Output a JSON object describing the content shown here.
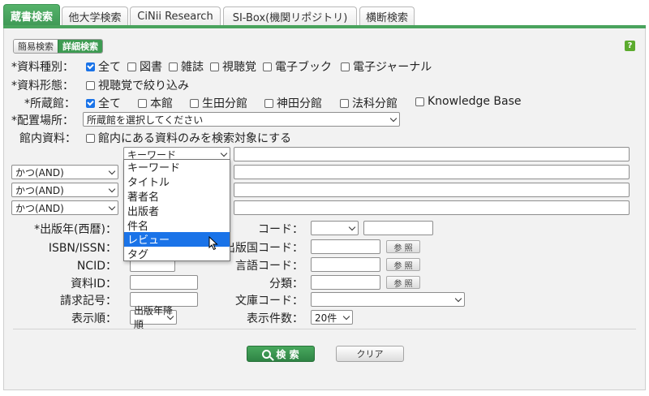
{
  "tabs": [
    "蔵書検索",
    "他大学検索",
    "CiNii Research",
    "SI-Box(機関リポジトリ)",
    "横断検索"
  ],
  "mode": {
    "simple": "簡易検索",
    "detail": "詳細検索"
  },
  "help": "?",
  "material_type": {
    "label": "*資料種別：",
    "options": [
      {
        "text": "全て",
        "checked": true
      },
      {
        "text": "図書",
        "checked": false
      },
      {
        "text": "雑誌",
        "checked": false
      },
      {
        "text": "視聴覚",
        "checked": false
      },
      {
        "text": "電子ブック",
        "checked": false
      },
      {
        "text": "電子ジャーナル",
        "checked": false
      }
    ]
  },
  "material_form": {
    "label": "*資料形態：",
    "option": "視聴覚で絞り込み"
  },
  "holding_library": {
    "label": "*所蔵館：",
    "options": [
      {
        "text": "全て",
        "checked": true
      },
      {
        "text": "本館",
        "checked": false
      },
      {
        "text": "生田分館",
        "checked": false
      },
      {
        "text": "神田分館",
        "checked": false
      },
      {
        "text": "法科分館",
        "checked": false
      },
      {
        "text": "Knowledge Base",
        "checked": false
      }
    ]
  },
  "location": {
    "label": "*配置場所：",
    "placeholder": "所蔵館を選択してください"
  },
  "in_library": {
    "label": "館内資料：",
    "option": "館内にある資料のみを検索対象にする"
  },
  "field_select": "キーワード",
  "bool_ops": [
    "かつ(AND)",
    "かつ(AND)",
    "かつ(AND)"
  ],
  "dropdown_items": [
    "キーワード",
    "タイトル",
    "著者名",
    "出版者",
    "件名",
    "レビュー",
    "タグ"
  ],
  "left_fields": [
    "*出版年(西暦)：",
    "ISBN/ISSN：",
    "NCID：",
    "資料ID：",
    "請求記号：",
    "表示順："
  ],
  "right_fields": [
    "コード：",
    "出版国コード：",
    "言語コード：",
    "分類：",
    "文庫コード：",
    "表示件数："
  ],
  "ref_label": "参 照",
  "sort_order": "出版年降順",
  "display_count": "20件",
  "search_button": "検 索",
  "clear_button": "クリア"
}
